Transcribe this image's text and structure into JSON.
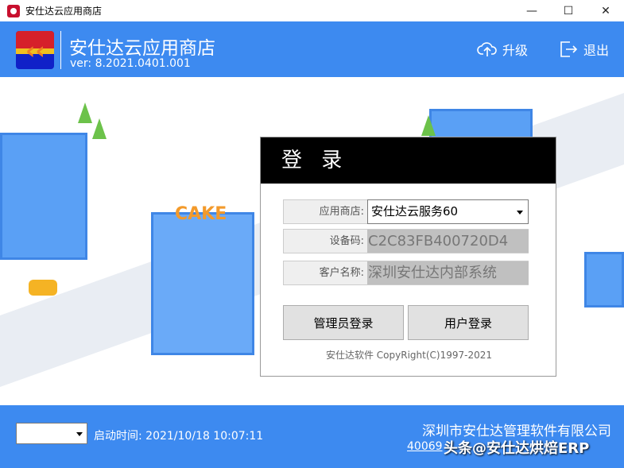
{
  "window": {
    "title": "安仕达云应用商店",
    "minimize": "—",
    "maximize": "☐",
    "close": "✕"
  },
  "header": {
    "app_name": "安仕达云应用商店",
    "version": "ver: 8.2021.0401.001",
    "upgrade_label": "升级",
    "exit_label": "退出"
  },
  "login": {
    "title": "登 录",
    "store_label": "应用商店:",
    "store_value": "安仕达云服务60",
    "device_label": "设备码:",
    "device_value": "C2C83FB400720D4",
    "customer_label": "客户名称:",
    "customer_value": "深圳安仕达内部系统",
    "admin_login": "管理员登录",
    "user_login": "用户登录",
    "copyright": "安仕达软件 CopyRight(C)1997-2021"
  },
  "scene": {
    "cake_sign": "CAKE"
  },
  "footer": {
    "start_time": "启动时间: 2021/10/18 10:07:11",
    "company": "深圳市安仕达管理软件有限公司",
    "phone": "40069",
    "watermark": "头条@安仕达烘焙ERP"
  }
}
